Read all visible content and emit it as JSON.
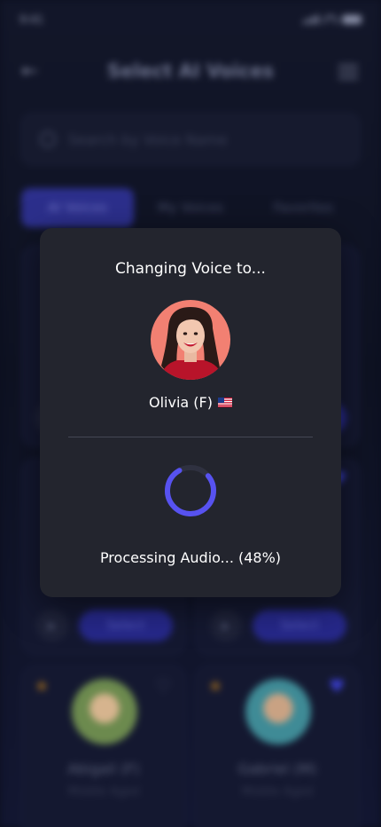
{
  "status_bar": {
    "time": "9:41"
  },
  "header": {
    "title": "Select AI Voices"
  },
  "search": {
    "placeholder": "Search by Voice Name"
  },
  "tabs": [
    {
      "label": "AI Voices",
      "active": true
    },
    {
      "label": "My Voices",
      "active": false
    },
    {
      "label": "Favorites",
      "active": false
    }
  ],
  "cards": {
    "select_label": "Select",
    "bottom": [
      {
        "name": "Abigail (F)",
        "sub": "Middle Aged"
      },
      {
        "name": "Gabriel (M)",
        "sub": "Middle Aged"
      }
    ]
  },
  "modal": {
    "title": "Changing Voice to...",
    "voice_label": "Olivia (F)",
    "flag_icon": "us-flag-icon",
    "progress": 0.48,
    "progress_text": "Processing Audio... (48%)"
  },
  "colors": {
    "accent": "#5752f0",
    "modal_bg": "#23252e",
    "avatar_bg": "#f28072"
  }
}
